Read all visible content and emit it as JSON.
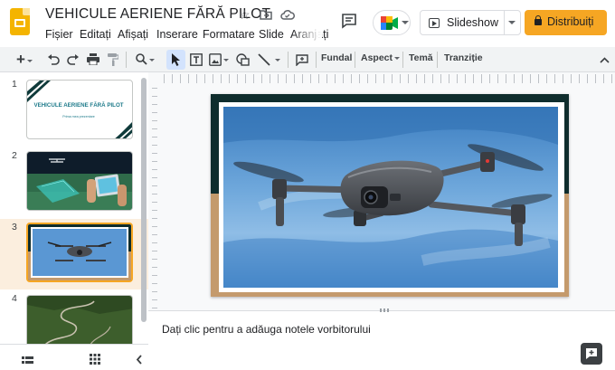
{
  "doc": {
    "title": "VEHICULE AERIENE FĂRĂ PILOT"
  },
  "menu": [
    "Fișier",
    "Editați",
    "Afișați",
    "Inserare",
    "Formatare",
    "Slide",
    "Aranjați"
  ],
  "header": {
    "slideshow_label": "Slideshow",
    "share_label": "Distribuiți"
  },
  "toolbar": {
    "background_label": "Fundal",
    "layout_label": "Aspect",
    "theme_label": "Temă",
    "transition_label": "Tranziție"
  },
  "slides": [
    {
      "number": "1",
      "title": "VEHICULE AERIENE FĂRĂ PILOT",
      "subtitle": "Prima mea prezentare"
    },
    {
      "number": "2"
    },
    {
      "number": "3"
    },
    {
      "number": "4"
    }
  ],
  "notes": {
    "placeholder": "Dați clic pentru a adăuga notele vorbitorului"
  },
  "colors": {
    "accent": "#f6a623",
    "slide_dark": "#0f2d2d",
    "slide_tan": "#c49a6c"
  },
  "icons": [
    "slides-logo-icon",
    "star-icon",
    "move-folder-icon",
    "cloud-icon",
    "comment-icon",
    "meet-icon",
    "lock-icon",
    "add-icon",
    "undo-icon",
    "redo-icon",
    "print-icon",
    "paint-format-icon",
    "zoom-icon",
    "select-icon",
    "text-box-icon",
    "image-icon",
    "shape-icon",
    "line-icon",
    "add-comment-icon",
    "collapse-icon",
    "grid-view-icon",
    "list-view-icon",
    "chevron-left-icon",
    "speaker-notes-icon"
  ]
}
